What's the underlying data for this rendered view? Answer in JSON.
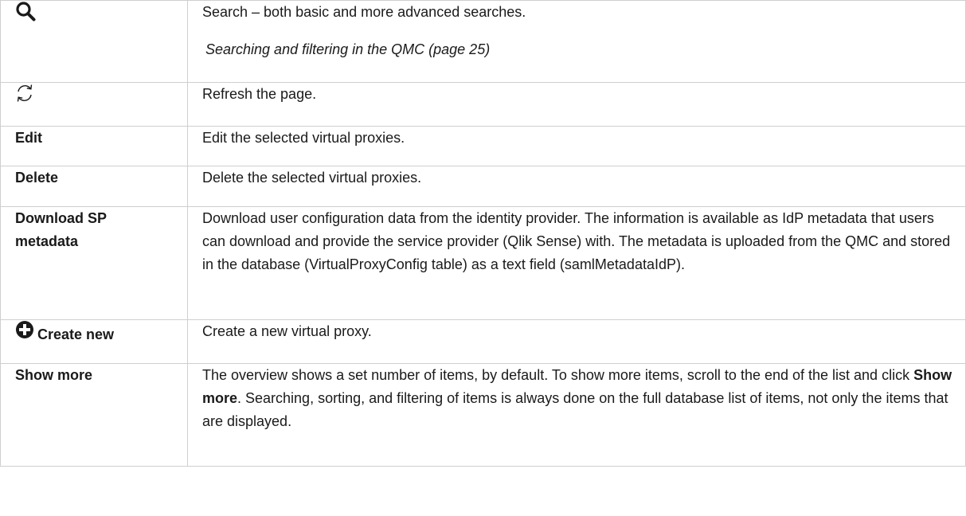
{
  "rows": [
    {
      "icon": "search-icon",
      "description": "Search – both basic and more advanced searches.",
      "link": "Searching and filtering in the QMC (page 25)"
    },
    {
      "icon": "refresh-icon",
      "description": "Refresh the page."
    },
    {
      "term": "Edit",
      "description": "Edit the selected virtual proxies."
    },
    {
      "term": "Delete",
      "description": "Delete the selected virtual proxies."
    },
    {
      "term": "Download SP metadata",
      "description": "Download user configuration data from the identity provider. The information is available as IdP metadata that users can download and provide the service provider (Qlik Sense) with. The metadata is uploaded from the QMC and stored in the database (VirtualProxyConfig table) as a text field (samlMetadataIdP)."
    },
    {
      "icon": "plus-circle-icon",
      "term": "Create new",
      "description": "Create a new virtual proxy."
    },
    {
      "term": "Show more",
      "description_before": "The overview shows a set number of items, by default. To show more items, scroll to the end of the list and click ",
      "description_bold": "Show more",
      "description_after": ". Searching, sorting, and filtering of items is always done on the full database list of items, not only the items that are displayed."
    }
  ]
}
